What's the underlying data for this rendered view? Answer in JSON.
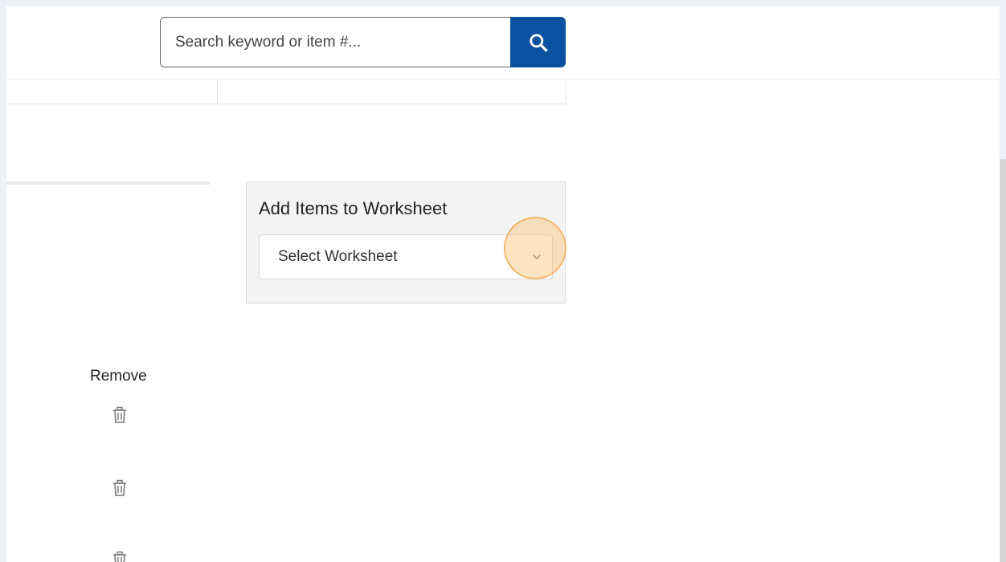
{
  "search": {
    "placeholder": "Search keyword or item #...",
    "value": ""
  },
  "worksheet": {
    "title": "Add Items to Worksheet",
    "selected": "Select Worksheet"
  },
  "items_table": {
    "remove_header": "Remove",
    "rows_visible": 3
  },
  "colors": {
    "search_button": "#0a52a1",
    "highlight": "#f8c27a",
    "panel_background": "#f4f4f4"
  },
  "icons": {
    "search": "search-icon",
    "chevron": "chevron-down-icon",
    "trash": "trash-icon"
  }
}
